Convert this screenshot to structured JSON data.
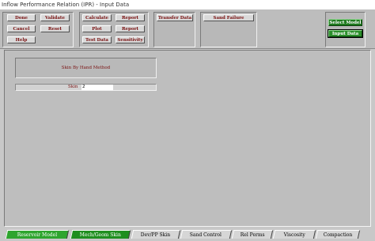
{
  "window": {
    "title": "Inflow Performance Relation (IPR) - Input Data"
  },
  "toolbar": {
    "done": "Done",
    "validate": "Validate",
    "cancel": "Cancel",
    "reset": "Reset",
    "help": "Help",
    "calculate": "Calculate",
    "report1": "Report",
    "plot": "Plot",
    "report2": "Report",
    "test_data": "Test Data",
    "sensitivity": "Sensitivity",
    "transfer_data": "Transfer Data",
    "sand_failure": "Sand Failure",
    "select_model": "Select Model",
    "input_data": "Input Data"
  },
  "main": {
    "method_title": "Skin By Hand Method",
    "skin_label": "Skin",
    "skin_value": "2"
  },
  "tabs": [
    {
      "label": "Reservoir Model"
    },
    {
      "label": "Mech/Geom Skin"
    },
    {
      "label": "Dev/PP Skin"
    },
    {
      "label": "Sand Control"
    },
    {
      "label": "Rel Perms"
    },
    {
      "label": "Viscosity"
    },
    {
      "label": "Compaction"
    }
  ],
  "colors": {
    "active_tab": "#2ea52e",
    "label_text": "#7a1111",
    "green_button": "#1f7a1f"
  }
}
